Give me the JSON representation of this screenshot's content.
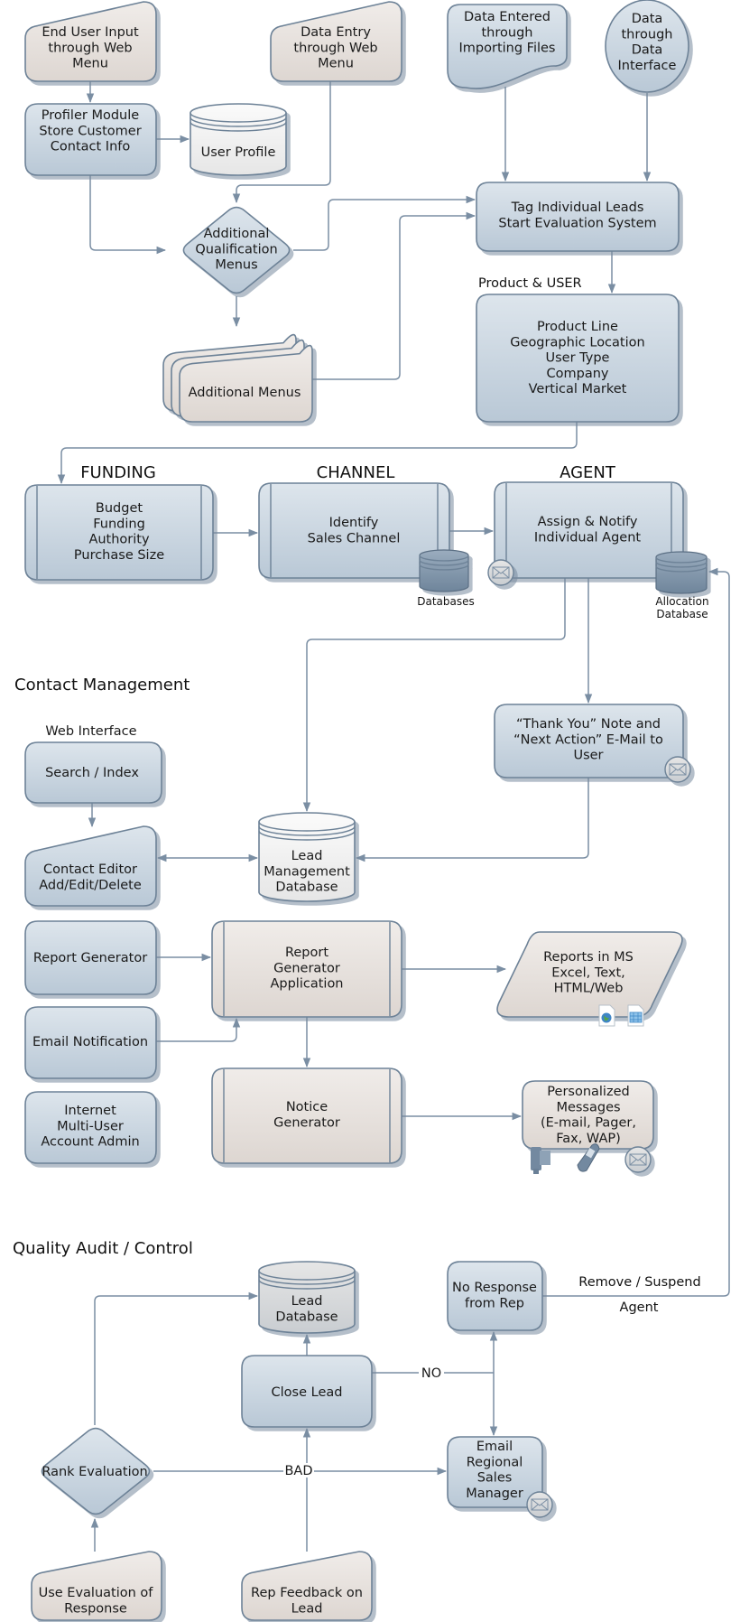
{
  "colors": {
    "node_blue": "#cfd9e3",
    "node_beige": "#e8e3e0",
    "stroke": "#6d8297",
    "connector": "#7a8ea3",
    "database_dark": "#7f95ab"
  },
  "nodes": {
    "end_user_input": {
      "lines": [
        "End User Input",
        "through Web",
        "Menu"
      ]
    },
    "data_entry_web": {
      "lines": [
        "Data Entry",
        "through Web",
        "Menu"
      ]
    },
    "data_importing_files": {
      "lines": [
        "Data Entered",
        "through",
        "Importing Files"
      ]
    },
    "data_interface": {
      "lines": [
        "Data",
        "through",
        "Data",
        "Interface"
      ]
    },
    "profiler_module": {
      "lines": [
        "Profiler Module",
        "",
        "Store Customer",
        "Contact Info"
      ]
    },
    "user_profile": {
      "lines": [
        "User Profile"
      ]
    },
    "additional_qualification": {
      "lines": [
        "Additional",
        "Qualification",
        "Menus"
      ]
    },
    "additional_menus": {
      "lines": [
        "Additional Menus"
      ]
    },
    "tag_leads": {
      "lines": [
        "Tag Individual Leads",
        "Start Evaluation System"
      ]
    },
    "product_user_criteria": {
      "lines": [
        "Product Line",
        "Geographic Location",
        "User Type",
        "Company",
        "Vertical Market"
      ]
    },
    "funding_box": {
      "lines": [
        "Budget",
        "Funding",
        "Authority",
        "Purchase Size"
      ]
    },
    "channel_box": {
      "lines": [
        "Identify",
        "Sales Channel"
      ]
    },
    "databases": {
      "lines": [
        "Databases"
      ]
    },
    "agent_box": {
      "lines": [
        "Assign & Notify",
        "Individual Agent"
      ]
    },
    "allocation_database": {
      "lines": [
        "Allocation",
        "Database"
      ]
    },
    "search_index": {
      "lines": [
        "Search / Index"
      ]
    },
    "contact_editor": {
      "lines": [
        "Contact Editor",
        "Add/Edit/Delete"
      ]
    },
    "lead_management_db": {
      "lines": [
        "Lead",
        "Management",
        "Database"
      ]
    },
    "thank_you_email": {
      "lines": [
        "“Thank You” Note and",
        "“Next Action” E-Mail to",
        "User"
      ]
    },
    "report_generator": {
      "lines": [
        "Report Generator"
      ]
    },
    "report_generator_app": {
      "lines": [
        "Report",
        "Generator",
        "Application"
      ]
    },
    "reports_ms": {
      "lines": [
        "Reports in MS",
        "Excel, Text,",
        "HTML/Web"
      ]
    },
    "email_notification": {
      "lines": [
        "Email Notification"
      ]
    },
    "internet_multiuser": {
      "lines": [
        "Internet",
        "Multi-User",
        "Account Admin"
      ]
    },
    "notice_generator": {
      "lines": [
        "Notice",
        "Generator"
      ]
    },
    "personalized_messages": {
      "lines": [
        "Personalized",
        "Messages",
        "(E-mail, Pager,",
        "Fax, WAP)"
      ]
    },
    "lead_database": {
      "lines": [
        "Lead",
        "Database"
      ]
    },
    "no_response": {
      "lines": [
        "No Response",
        "from Rep"
      ]
    },
    "close_lead": {
      "lines": [
        "Close Lead"
      ]
    },
    "rank_evaluation": {
      "lines": [
        "Rank Evaluation"
      ]
    },
    "email_regional_manager": {
      "lines": [
        "Email",
        "Regional",
        "Sales",
        "Manager"
      ]
    },
    "use_evaluation": {
      "lines": [
        "Use Evaluation of",
        "Response"
      ]
    },
    "rep_feedback": {
      "lines": [
        "Rep Feedback on",
        "Lead"
      ]
    }
  },
  "labels": {
    "product_user": "Product & USER",
    "funding": "FUNDING",
    "channel": "CHANNEL",
    "agent": "AGENT",
    "contact_management": "Contact Management",
    "web_interface": "Web Interface",
    "quality_audit": "Quality Audit / Control",
    "remove_suspend": "Remove / Suspend",
    "agent_edge": "Agent",
    "no": "NO",
    "bad": "BAD"
  },
  "icons": [
    "email-icon",
    "database-icon",
    "web-document-icon",
    "spreadsheet-icon",
    "fax-icon",
    "mobile-phone-icon"
  ]
}
